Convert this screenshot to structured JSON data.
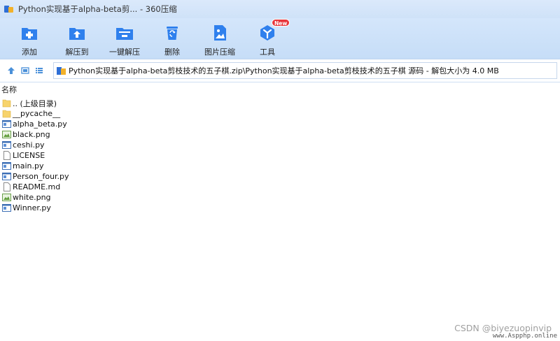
{
  "window": {
    "title": "Python实现基于alpha-beta剪... - 360压缩"
  },
  "toolbar": {
    "items": [
      {
        "label": "添加",
        "icon": "add-icon"
      },
      {
        "label": "解压到",
        "icon": "extract-to-icon"
      },
      {
        "label": "一键解压",
        "icon": "one-click-extract-icon"
      },
      {
        "label": "删除",
        "icon": "delete-icon"
      },
      {
        "label": "图片压缩",
        "icon": "image-compress-icon"
      },
      {
        "label": "工具",
        "icon": "tools-icon",
        "badge": "New"
      }
    ]
  },
  "address": {
    "path": "Python实现基于alpha-beta剪枝技术的五子棋.zip\\Python实现基于alpha-beta剪枝技术的五子棋 源码 - 解包大小为 4.0 MB"
  },
  "list": {
    "column_name": "名称",
    "files": [
      {
        "name": ".. (上级目录)",
        "icon": "folder-up-icon"
      },
      {
        "name": "__pycache__",
        "icon": "folder-icon"
      },
      {
        "name": "alpha_beta.py",
        "icon": "python-file-icon"
      },
      {
        "name": "black.png",
        "icon": "image-file-icon"
      },
      {
        "name": "ceshi.py",
        "icon": "python-file-icon"
      },
      {
        "name": "LICENSE",
        "icon": "blank-file-icon"
      },
      {
        "name": "main.py",
        "icon": "python-file-icon"
      },
      {
        "name": "Person_four.py",
        "icon": "python-file-icon"
      },
      {
        "name": "README.md",
        "icon": "blank-file-icon"
      },
      {
        "name": "white.png",
        "icon": "image-file-icon"
      },
      {
        "name": "Winner.py",
        "icon": "python-file-icon"
      }
    ]
  },
  "watermark": {
    "text": "CSDN @biyezuopinvip",
    "site": "www.Aspphp.online"
  },
  "colors": {
    "accent": "#2f80ed",
    "toolbar_bg": "#c9dff8",
    "badge": "#e8343a"
  }
}
